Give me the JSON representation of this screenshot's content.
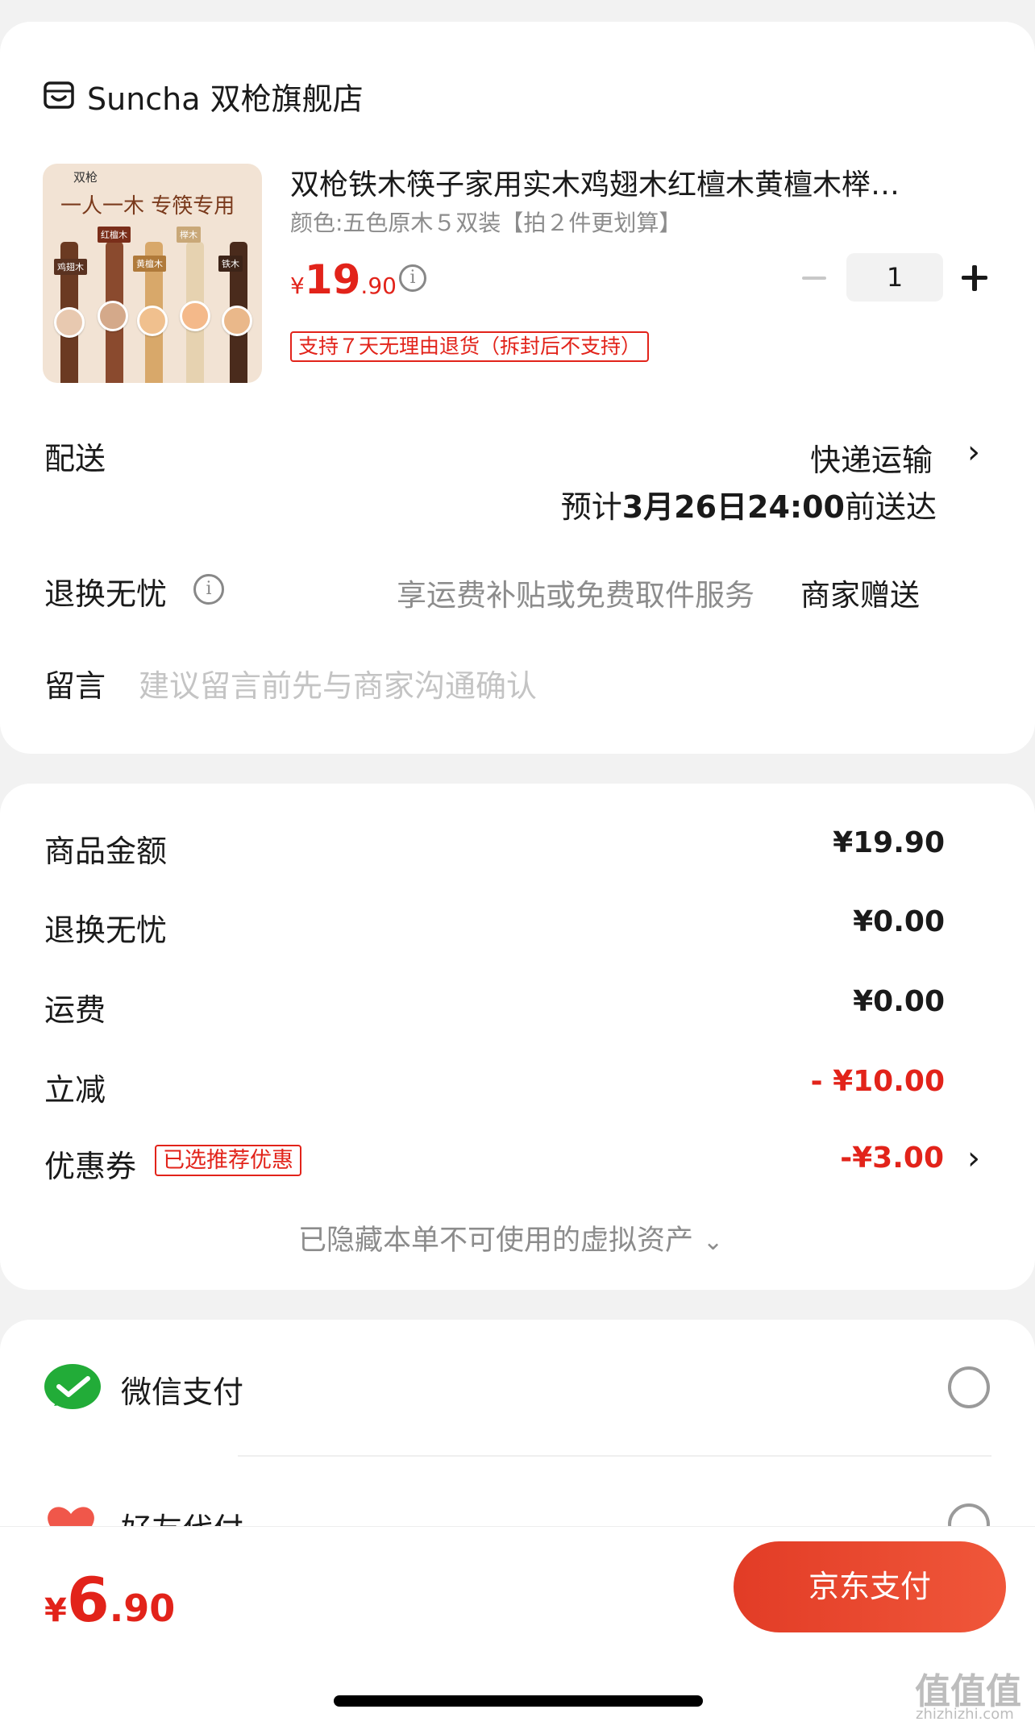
{
  "store": {
    "name": "Suncha 双枪旗舰店",
    "icon": "store-icon"
  },
  "product": {
    "title": "双枪铁木筷子家用实木鸡翅木红檀木黄檀木榉…",
    "variant": "颜色:五色原木５双装【拍２件更划算】",
    "price_symbol": "¥",
    "price_int": "19",
    "price_dec": ".90",
    "quantity": "1",
    "return_badge": "支持７天无理由退货（拆封后不支持）",
    "image": {
      "brand": "双枪",
      "slogan": "一人一木 专筷专用",
      "tags": [
        "红檀木",
        "鸡翅木",
        "黄檀木",
        "榉木",
        "铁木"
      ]
    }
  },
  "delivery": {
    "label": "配送",
    "method": "快递运输",
    "eta_prefix": "预计",
    "eta_date": "3月26日24:00",
    "eta_suffix": "前送达"
  },
  "return_worry": {
    "label": "退换无忧",
    "desc": "享运费补贴或免费取件服务",
    "gift": "商家赠送"
  },
  "message": {
    "label": "留言",
    "placeholder": "建议留言前先与商家沟通确认"
  },
  "summary": {
    "goods_label": "商品金额",
    "goods_value": "¥19.90",
    "return_label": "退换无忧",
    "return_value": "¥0.00",
    "shipping_label": "运费",
    "shipping_value": "¥0.00",
    "discount_label": "立减",
    "discount_value": "- ¥10.00",
    "coupon_label": "优惠券",
    "coupon_badge": "已选推荐优惠",
    "coupon_value": "-¥3.00",
    "hidden_assets": "已隐藏本单不可使用的虚拟资产"
  },
  "payment": {
    "wechat_label": "微信支付",
    "friend_label": "好友代付"
  },
  "footer": {
    "total_symbol": "¥",
    "total_int": "6",
    "total_dec": ".90",
    "pay_button": "京东支付"
  },
  "watermark": {
    "site": "zhizhizhi.com",
    "logo": "值值值"
  },
  "colors": {
    "accent": "#e2231a",
    "wechat": "#22ac38",
    "bg": "#f2f2f2"
  }
}
